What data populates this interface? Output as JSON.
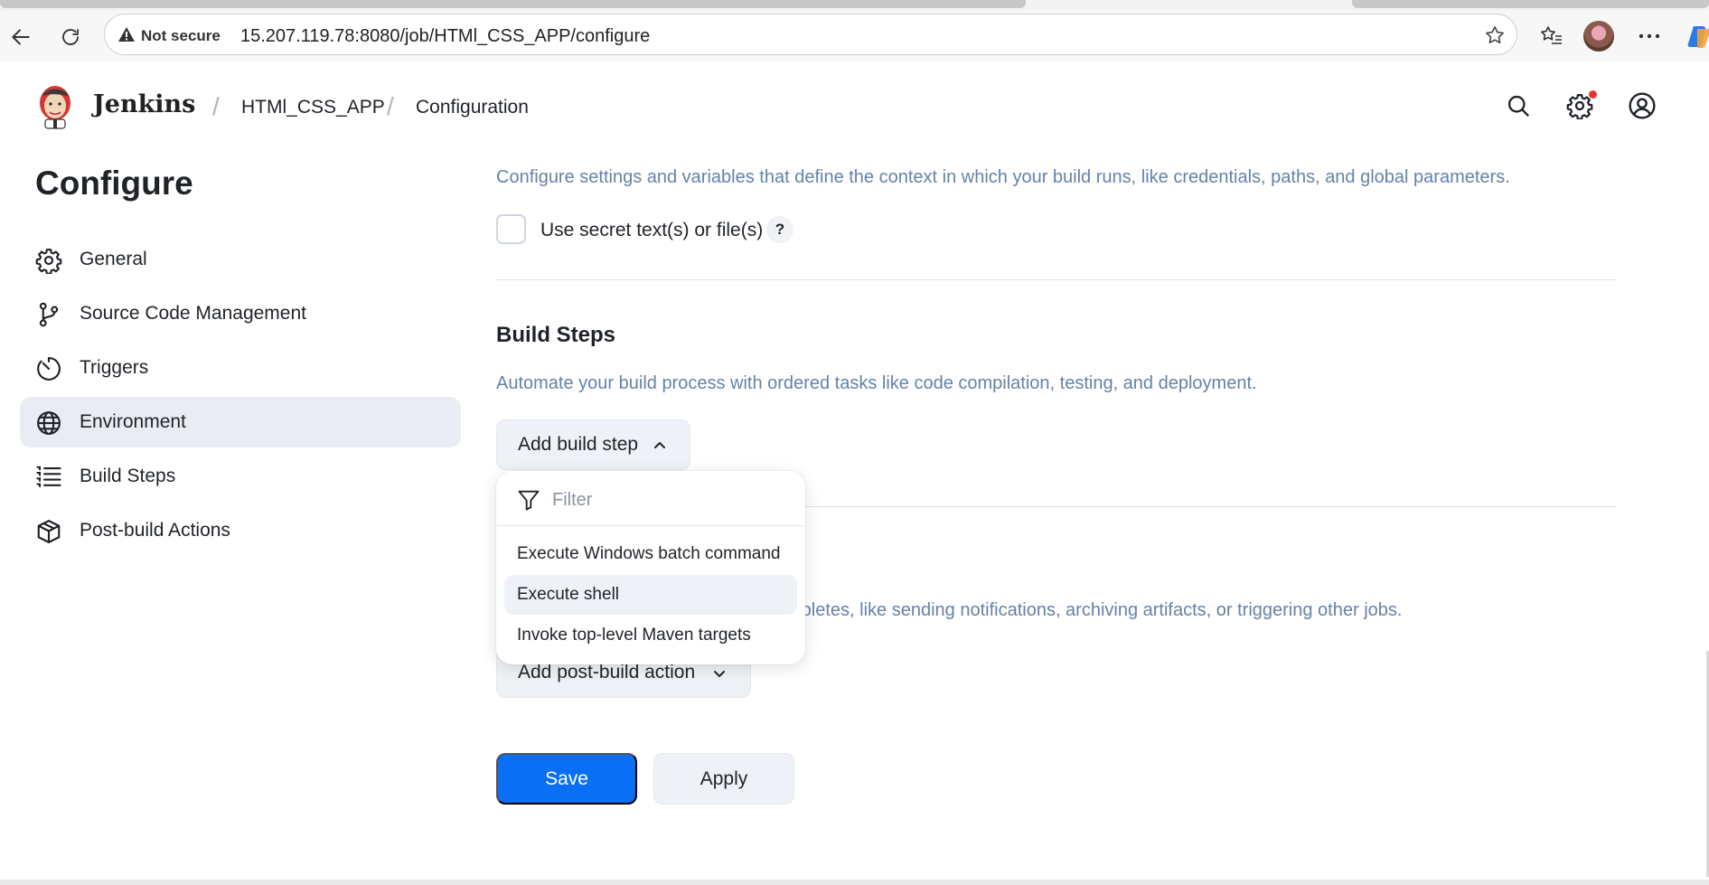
{
  "browser": {
    "security_label": "Not secure",
    "url": "15.207.119.78:8080/job/HTMl_CSS_APP/configure"
  },
  "header": {
    "brand": "Jenkins",
    "breadcrumbs": [
      "HTMl_CSS_APP",
      "Configuration"
    ]
  },
  "sidebar": {
    "title": "Configure",
    "items": [
      {
        "label": "General",
        "icon": "gear-icon"
      },
      {
        "label": "Source Code Management",
        "icon": "branch-icon"
      },
      {
        "label": "Triggers",
        "icon": "timer-icon"
      },
      {
        "label": "Environment",
        "icon": "globe-icon",
        "active": true
      },
      {
        "label": "Build Steps",
        "icon": "list-icon"
      },
      {
        "label": "Post-build Actions",
        "icon": "package-icon"
      }
    ]
  },
  "environment": {
    "description": "Configure settings and variables that define the context in which your build runs, like credentials, paths, and global parameters.",
    "checkbox_label": "Use secret text(s) or file(s)",
    "checkbox_checked": false,
    "help": "?"
  },
  "build_steps": {
    "title": "Build Steps",
    "description": "Automate your build process with ordered tasks like code compilation, testing, and deployment.",
    "add_button": "Add build step"
  },
  "dropdown": {
    "filter_placeholder": "Filter",
    "items": [
      "Execute Windows batch command",
      "Execute shell",
      "Invoke top-level Maven targets"
    ],
    "hovered": "Execute shell"
  },
  "post_build": {
    "description_visible": "mpletes, like sending notifications, archiving artifacts, or triggering other jobs.",
    "add_button": "Add post-build action"
  },
  "actions": {
    "save": "Save",
    "apply": "Apply"
  },
  "colors": {
    "primary": "#0a6ff5",
    "description_text": "#6682a8",
    "active_nav_bg": "#e9edf3"
  }
}
